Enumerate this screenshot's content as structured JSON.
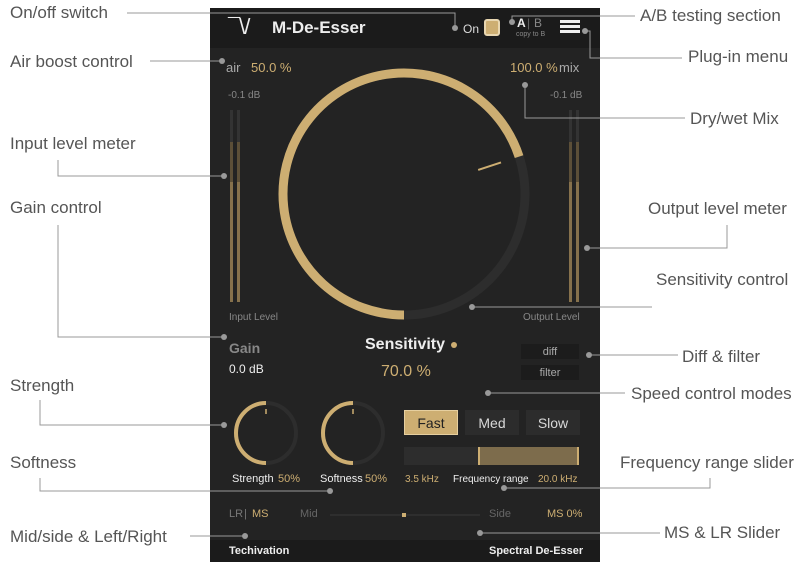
{
  "annotations": {
    "on_off": "On/off switch",
    "ab": "A/B testing section",
    "air": "Air boost control",
    "menu": "Plug-in menu",
    "input_meter": "Input level meter",
    "drywet": "Dry/wet Mix",
    "gain": "Gain control",
    "output_meter": "Output level meter",
    "sensitivity": "Sensitivity control",
    "strength": "Strength",
    "diff_filter": "Diff & filter",
    "speed": "Speed control modes",
    "softness": "Softness",
    "freq": "Frequency range slider",
    "midside": "Mid/side & Left/Right",
    "ms_slider": "MS & LR Slider"
  },
  "header": {
    "logo": "¯\\/",
    "title": "M-De-Esser",
    "on_label": "On",
    "on_state": true,
    "a": "A",
    "sep": "|",
    "b": "B",
    "copy": "copy to B",
    "menu_icon": "hamburger-icon"
  },
  "air": {
    "label": "air",
    "value": "50.0 %"
  },
  "mix": {
    "label": "mix",
    "value": "100.0 %"
  },
  "input_meter": {
    "peak": "-0.1 dB",
    "label": "Input Level"
  },
  "output_meter": {
    "peak": "-0.1 dB",
    "label": "Output Level"
  },
  "gain": {
    "label": "Gain",
    "value": "0.0 dB"
  },
  "sensitivity": {
    "label": "Sensitivity",
    "value": "70.0 %",
    "fraction": 0.7
  },
  "diff_label": "diff",
  "filter_label": "filter",
  "strength": {
    "label": "Strength",
    "value": "50%",
    "fraction": 0.5
  },
  "softness": {
    "label": "Softness",
    "value": "50%",
    "fraction": 0.5
  },
  "speed": {
    "options": [
      "Fast",
      "Med",
      "Slow"
    ],
    "selected": "Fast"
  },
  "freq": {
    "low": "3.5 kHz",
    "label": "Frequency range",
    "high": "20.0 kHz"
  },
  "stereo": {
    "lr": "LR",
    "sep": "|",
    "ms": "MS",
    "mid": "Mid",
    "side": "Side",
    "value": "MS 0%"
  },
  "footer": {
    "brand": "Techivation",
    "product": "Spectral De-Esser"
  },
  "colors": {
    "accent": "#cdae72",
    "background": "#232323"
  }
}
